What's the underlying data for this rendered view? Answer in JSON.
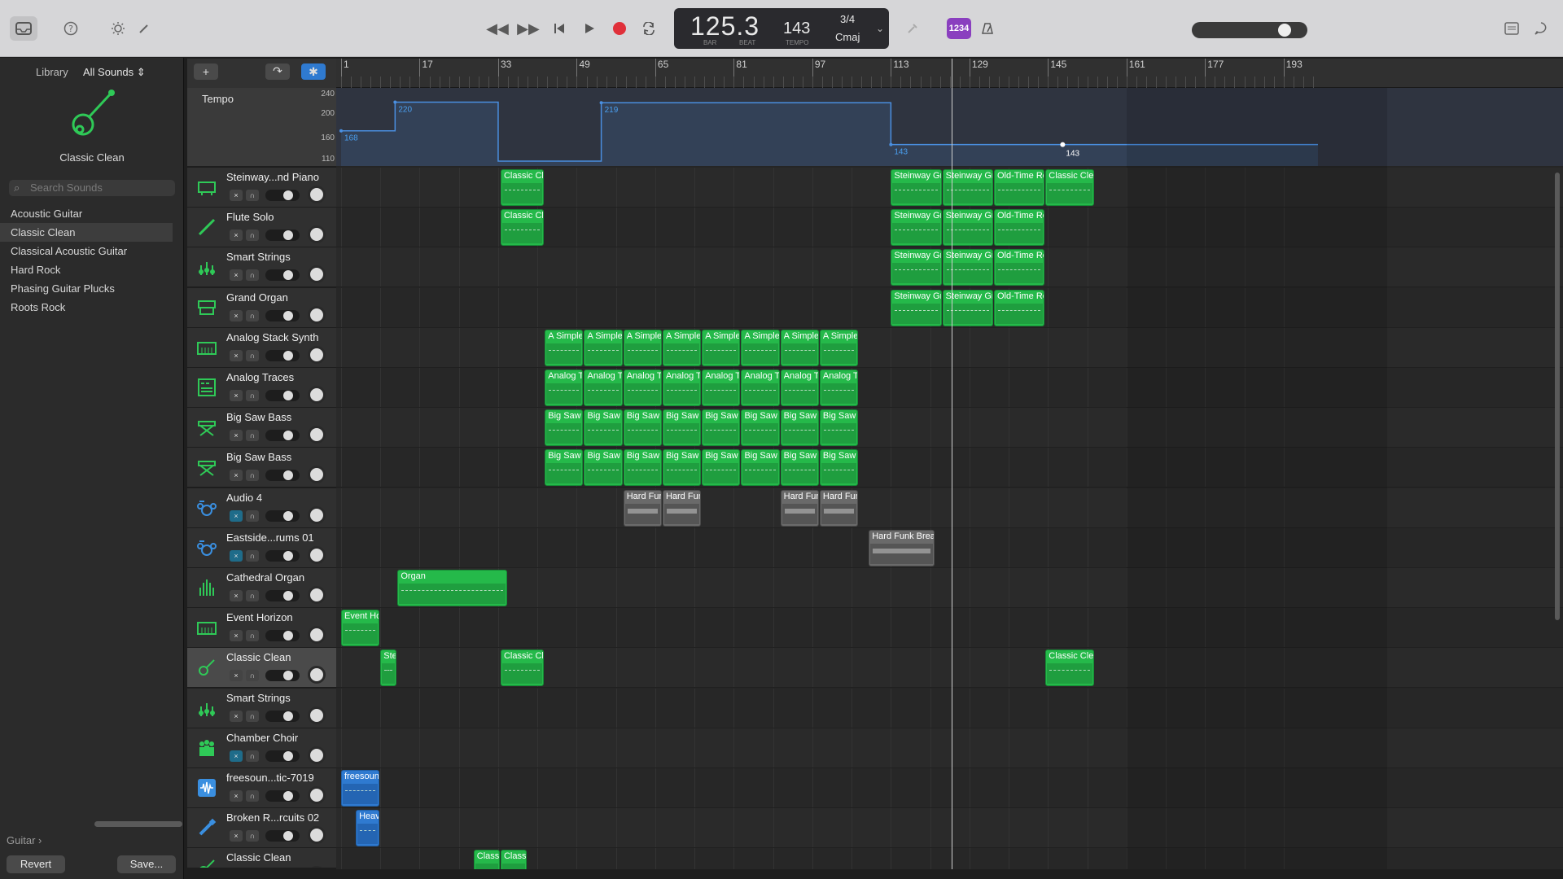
{
  "control_bar": {
    "position": "125.3",
    "bar_label": "BAR",
    "beat_label": "BEAT",
    "tempo": "143",
    "tempo_label": "TEMPO",
    "time_signature": "3/4",
    "key": "Cmaj",
    "count_in": "1234",
    "icons": [
      "library-icon",
      "help-icon",
      "brightness-icon",
      "pencil-icon",
      "rewind-icon",
      "fast-forward-icon",
      "go-to-start-icon",
      "play-icon",
      "record-icon",
      "cycle-icon",
      "tuner-icon",
      "metronome-icon",
      "notes-icon",
      "chat-icon"
    ],
    "accent_color": "#8a3fbf",
    "record_color": "#e0303a"
  },
  "library": {
    "title": "Library",
    "filter": "All Sounds",
    "current_patch": "Classic Clean",
    "search_placeholder": "Search Sounds",
    "items": [
      {
        "label": "Acoustic Guitar",
        "selected": false
      },
      {
        "label": "Classic Clean",
        "selected": true
      },
      {
        "label": "Classical Acoustic Guitar",
        "selected": false
      },
      {
        "label": "Hard Rock",
        "selected": false
      },
      {
        "label": "Phasing Guitar Plucks",
        "selected": false
      },
      {
        "label": "Roots Rock",
        "selected": false
      }
    ],
    "breadcrumb": "Guitar",
    "revert_label": "Revert",
    "save_label": "Save..."
  },
  "tempo_track": {
    "label": "Tempo",
    "scale": [
      "240",
      "200",
      "160",
      "110"
    ],
    "points": [
      {
        "bar": 1,
        "value": "168"
      },
      {
        "bar": 21,
        "value": "220"
      },
      {
        "bar": 57,
        "value": "219"
      },
      {
        "bar": 113,
        "value": "143"
      },
      {
        "bar": 148,
        "value": "143"
      }
    ]
  },
  "ruler": {
    "bars": [
      "1",
      "17",
      "33",
      "49",
      "65",
      "81",
      "97",
      "113",
      "129",
      "145",
      "161",
      "177",
      "193"
    ]
  },
  "tracks": [
    {
      "name": "Steinway...nd Piano",
      "icon": "piano-icon",
      "muted": false,
      "selected": false
    },
    {
      "name": "Flute Solo",
      "icon": "flute-icon",
      "muted": false,
      "selected": false
    },
    {
      "name": "Smart Strings",
      "icon": "strings-icon",
      "muted": false,
      "selected": false
    },
    {
      "name": "Grand Organ",
      "icon": "organ-icon",
      "muted": false,
      "selected": false
    },
    {
      "name": "Analog Stack Synth",
      "icon": "synth-icon",
      "muted": false,
      "selected": false
    },
    {
      "name": "Analog Traces",
      "icon": "synth-grid-icon",
      "muted": false,
      "selected": false
    },
    {
      "name": "Big Saw Bass",
      "icon": "keyboard-stand-icon",
      "muted": false,
      "selected": false
    },
    {
      "name": "Big Saw Bass",
      "icon": "keyboard-stand-icon",
      "muted": false,
      "selected": false
    },
    {
      "name": "Audio 4",
      "icon": "drum-kit-icon",
      "muted": true,
      "selected": false
    },
    {
      "name": "Eastside...rums 01",
      "icon": "drum-kit-icon",
      "muted": true,
      "selected": false
    },
    {
      "name": "Cathedral Organ",
      "icon": "pipe-organ-icon",
      "muted": false,
      "selected": false
    },
    {
      "name": "Event Horizon",
      "icon": "synth-icon",
      "muted": false,
      "selected": false
    },
    {
      "name": "Classic Clean",
      "icon": "guitar-icon",
      "muted": false,
      "selected": true
    },
    {
      "name": "Smart Strings",
      "icon": "strings-icon",
      "muted": false,
      "selected": false
    },
    {
      "name": "Chamber Choir",
      "icon": "choir-icon",
      "muted": true,
      "selected": false
    },
    {
      "name": "freesoun...tic-7019",
      "icon": "waveform-icon",
      "muted": false,
      "selected": false
    },
    {
      "name": "Broken R...rcuits 02",
      "icon": "brush-icon",
      "muted": false,
      "selected": false
    },
    {
      "name": "Classic Clean",
      "icon": "guitar-icon",
      "muted": false,
      "selected": false
    }
  ],
  "regions": [
    {
      "track": 0,
      "label": "Classic Clea",
      "start": 33.5,
      "end": 42.5,
      "kind": "midi"
    },
    {
      "track": 0,
      "label": "Steinway Gra",
      "start": 113,
      "end": 123.5,
      "kind": "midi"
    },
    {
      "track": 0,
      "label": "Steinway Gra",
      "start": 123.5,
      "end": 134,
      "kind": "midi"
    },
    {
      "track": 0,
      "label": "Old-Time Re",
      "start": 134,
      "end": 144.5,
      "kind": "midi"
    },
    {
      "track": 0,
      "label": "Classic Clea",
      "start": 144.5,
      "end": 154.5,
      "kind": "midi"
    },
    {
      "track": 1,
      "label": "Classic Clea",
      "start": 33.5,
      "end": 42.5,
      "kind": "midi"
    },
    {
      "track": 1,
      "label": "Steinway Gra",
      "start": 113,
      "end": 123.5,
      "kind": "midi"
    },
    {
      "track": 1,
      "label": "Steinway Gra",
      "start": 123.5,
      "end": 134,
      "kind": "midi"
    },
    {
      "track": 1,
      "label": "Old-Time Rec",
      "start": 134,
      "end": 144.5,
      "kind": "midi"
    },
    {
      "track": 2,
      "label": "Steinway Gra",
      "start": 113,
      "end": 123.5,
      "kind": "midi"
    },
    {
      "track": 2,
      "label": "Steinway Gra",
      "start": 123.5,
      "end": 134,
      "kind": "midi"
    },
    {
      "track": 2,
      "label": "Old-Time Rec",
      "start": 134,
      "end": 144.5,
      "kind": "midi"
    },
    {
      "track": 3,
      "label": "Steinway Gra",
      "start": 113,
      "end": 123.5,
      "kind": "midi"
    },
    {
      "track": 3,
      "label": "Steinway Gra",
      "start": 123.5,
      "end": 134,
      "kind": "midi"
    },
    {
      "track": 3,
      "label": "Old-Time Rec",
      "start": 134,
      "end": 144.5,
      "kind": "midi"
    },
    {
      "track": 4,
      "label": "A Simpler",
      "start": 42.5,
      "end": 50.5,
      "kind": "midi"
    },
    {
      "track": 4,
      "label": "A Simpler",
      "start": 50.5,
      "end": 58.5,
      "kind": "midi"
    },
    {
      "track": 4,
      "label": "A Simpler",
      "start": 58.5,
      "end": 66.5,
      "kind": "midi"
    },
    {
      "track": 4,
      "label": "A Simpler",
      "start": 66.5,
      "end": 74.5,
      "kind": "midi"
    },
    {
      "track": 4,
      "label": "A Simpler",
      "start": 74.5,
      "end": 82.5,
      "kind": "midi"
    },
    {
      "track": 4,
      "label": "A Simpler",
      "start": 82.5,
      "end": 90.5,
      "kind": "midi"
    },
    {
      "track": 4,
      "label": "A Simpler",
      "start": 90.5,
      "end": 98.5,
      "kind": "midi"
    },
    {
      "track": 4,
      "label": "A Simpler",
      "start": 98.5,
      "end": 106.5,
      "kind": "midi"
    },
    {
      "track": 5,
      "label": "Analog Tr",
      "start": 42.5,
      "end": 50.5,
      "kind": "midi"
    },
    {
      "track": 5,
      "label": "Analog Tr",
      "start": 50.5,
      "end": 58.5,
      "kind": "midi"
    },
    {
      "track": 5,
      "label": "Analog Tr",
      "start": 58.5,
      "end": 66.5,
      "kind": "midi"
    },
    {
      "track": 5,
      "label": "Analog Tr",
      "start": 66.5,
      "end": 74.5,
      "kind": "midi"
    },
    {
      "track": 5,
      "label": "Analog Tr",
      "start": 74.5,
      "end": 82.5,
      "kind": "midi"
    },
    {
      "track": 5,
      "label": "Analog Tr",
      "start": 82.5,
      "end": 90.5,
      "kind": "midi"
    },
    {
      "track": 5,
      "label": "Analog Tr",
      "start": 90.5,
      "end": 98.5,
      "kind": "midi"
    },
    {
      "track": 5,
      "label": "Analog Tr",
      "start": 98.5,
      "end": 106.5,
      "kind": "midi"
    },
    {
      "track": 6,
      "label": "Big Saw B",
      "start": 42.5,
      "end": 50.5,
      "kind": "midi"
    },
    {
      "track": 6,
      "label": "Big Saw B",
      "start": 50.5,
      "end": 58.5,
      "kind": "midi"
    },
    {
      "track": 6,
      "label": "Big Saw B",
      "start": 58.5,
      "end": 66.5,
      "kind": "midi"
    },
    {
      "track": 6,
      "label": "Big Saw B",
      "start": 66.5,
      "end": 74.5,
      "kind": "midi"
    },
    {
      "track": 6,
      "label": "Big Saw B",
      "start": 74.5,
      "end": 82.5,
      "kind": "midi"
    },
    {
      "track": 6,
      "label": "Big Saw B",
      "start": 82.5,
      "end": 90.5,
      "kind": "midi"
    },
    {
      "track": 6,
      "label": "Big Saw B",
      "start": 90.5,
      "end": 98.5,
      "kind": "midi"
    },
    {
      "track": 6,
      "label": "Big Saw B",
      "start": 98.5,
      "end": 106.5,
      "kind": "midi"
    },
    {
      "track": 7,
      "label": "Big Saw B",
      "start": 42.5,
      "end": 50.5,
      "kind": "midi"
    },
    {
      "track": 7,
      "label": "Big Saw B",
      "start": 50.5,
      "end": 58.5,
      "kind": "midi"
    },
    {
      "track": 7,
      "label": "Big Saw B",
      "start": 58.5,
      "end": 66.5,
      "kind": "midi"
    },
    {
      "track": 7,
      "label": "Big Saw B",
      "start": 66.5,
      "end": 74.5,
      "kind": "midi"
    },
    {
      "track": 7,
      "label": "Big Saw B",
      "start": 74.5,
      "end": 82.5,
      "kind": "midi"
    },
    {
      "track": 7,
      "label": "Big Saw B",
      "start": 82.5,
      "end": 90.5,
      "kind": "midi"
    },
    {
      "track": 7,
      "label": "Big Saw B",
      "start": 90.5,
      "end": 98.5,
      "kind": "midi"
    },
    {
      "track": 7,
      "label": "Big Saw B",
      "start": 98.5,
      "end": 106.5,
      "kind": "midi"
    },
    {
      "track": 8,
      "label": "Hard Fun",
      "start": 58.5,
      "end": 66.5,
      "kind": "audio"
    },
    {
      "track": 8,
      "label": "Hard Fun",
      "start": 66.5,
      "end": 74.5,
      "kind": "audio"
    },
    {
      "track": 8,
      "label": "Hard Fun",
      "start": 90.5,
      "end": 98.5,
      "kind": "audio"
    },
    {
      "track": 8,
      "label": "Hard Fun",
      "start": 98.5,
      "end": 106.5,
      "kind": "audio"
    },
    {
      "track": 9,
      "label": "Hard Funk Break",
      "start": 108.5,
      "end": 122,
      "kind": "audio"
    },
    {
      "track": 10,
      "label": "Organ",
      "start": 12.5,
      "end": 35,
      "kind": "midi"
    },
    {
      "track": 11,
      "label": "Event Hor",
      "start": 1,
      "end": 9,
      "kind": "midi"
    },
    {
      "track": 12,
      "label": "Ste",
      "start": 9,
      "end": 12.5,
      "kind": "midi"
    },
    {
      "track": 12,
      "label": "Classic Clea",
      "start": 33.5,
      "end": 42.5,
      "kind": "midi"
    },
    {
      "track": 12,
      "label": "Classic Clea",
      "start": 144.5,
      "end": 154.5,
      "kind": "midi"
    },
    {
      "track": 15,
      "label": "freesoun",
      "start": 1,
      "end": 9,
      "kind": "blue"
    },
    {
      "track": 16,
      "label": "Heav",
      "start": 4,
      "end": 9,
      "kind": "blue"
    },
    {
      "track": 17,
      "label": "Classi",
      "start": 28,
      "end": 33.5,
      "kind": "midi"
    },
    {
      "track": 17,
      "label": "Classi",
      "start": 33.5,
      "end": 39,
      "kind": "midi"
    }
  ],
  "playhead_bar": 125.3
}
